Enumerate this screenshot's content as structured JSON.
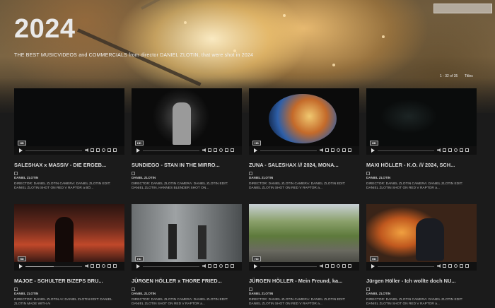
{
  "search": {
    "placeholder": ""
  },
  "hero": {
    "title": "2024",
    "subtitle": "THE BEST MUSICVIDEOS and COMMERCIALS from director DANIEL ZLOTIN, that were shot in 2024",
    "count": "1 - 32 of 35",
    "sort": "Titles"
  },
  "videos": [
    {
      "title": "SALESHAX x MASSIV - DIE ERGEB...",
      "author": "DANIEL ZLOTIN",
      "desc": "DIRECTOR: DANIEL ZLOTIN CAMERA: DANIEL ZLOTIN EDIT: DANIEL ZLOTIN SHOT ON RED V RAPTOR a BÖ...",
      "badge": "HD",
      "progress": 0
    },
    {
      "title": "SUNDIEGO - STAN IN THE MIRRO...",
      "author": "DANIEL ZLOTIN",
      "desc": "DIRECTOR: DANIEL ZLOTIN CAMERA: DANIEL ZLOTIN EDIT: DANIEL ZLOTIN, HANNES BLENDER SHOT ON...",
      "badge": "HD",
      "progress": 0
    },
    {
      "title": "ZUNA - SALESHAX /// 2024, MONA...",
      "author": "DANIEL ZLOTIN",
      "desc": "DIRECTOR: DANIEL ZLOTIN CAMERA: DANIEL ZLOTIN EDIT: DANIEL ZLOTIN SHOT ON RED V RAPTOR a...",
      "badge": "HD",
      "progress": 0
    },
    {
      "title": "MAXI HÖLLER - K.O. /// 2024, SCH...",
      "author": "DANIEL ZLOTIN",
      "desc": "DIRECTOR: DANIEL ZLOTIN CAMERA: DANIEL ZLOTIN EDIT: DANIEL ZLOTIN SHOT ON RED V RAPTOR a...",
      "badge": "HD",
      "progress": 0
    },
    {
      "title": "MAJOE - SCHULTER BIZEPS BRU...",
      "author": "DANIEL ZLOTIN",
      "desc": "DIRECTOR: DANIEL ZLOTIN AI: DANIEL ZLOTIN EDIT: DANIEL ZLOTIN MADE WITH AI",
      "badge": "HD",
      "progress": 0.5
    },
    {
      "title": "JÜRGEN HÖLLER x THORE FRIED...",
      "author": "DANIEL ZLOTIN",
      "desc": "DIRECTOR: DANIEL ZLOTIN CAMERA: DANIEL ZLOTIN EDIT: DANIEL ZLOTIN SHOT ON RED V RAPTOR a...",
      "badge": "HD",
      "progress": 0
    },
    {
      "title": "JÜRGEN HÖLLER - Mein Freund, ka...",
      "author": "DANIEL ZLOTIN",
      "desc": "DIRECTOR: DANIEL ZLOTIN CAMERA: DANIEL ZLOTIN EDIT: DANIEL ZLOTIN SHOT ON RED V RAPTOR a...",
      "badge": "HD",
      "progress": 0
    },
    {
      "title": "Jürgen Höller - Ich wollte doch NU...",
      "author": "DANIEL ZLOTIN",
      "desc": "DIRECTOR: DANIEL ZLOTIN CAMERA: DANIEL ZLOTIN EDIT: DANIEL ZLOTIN SHOT ON RED V RAPTOR a...",
      "badge": "HD",
      "progress": 0
    }
  ]
}
